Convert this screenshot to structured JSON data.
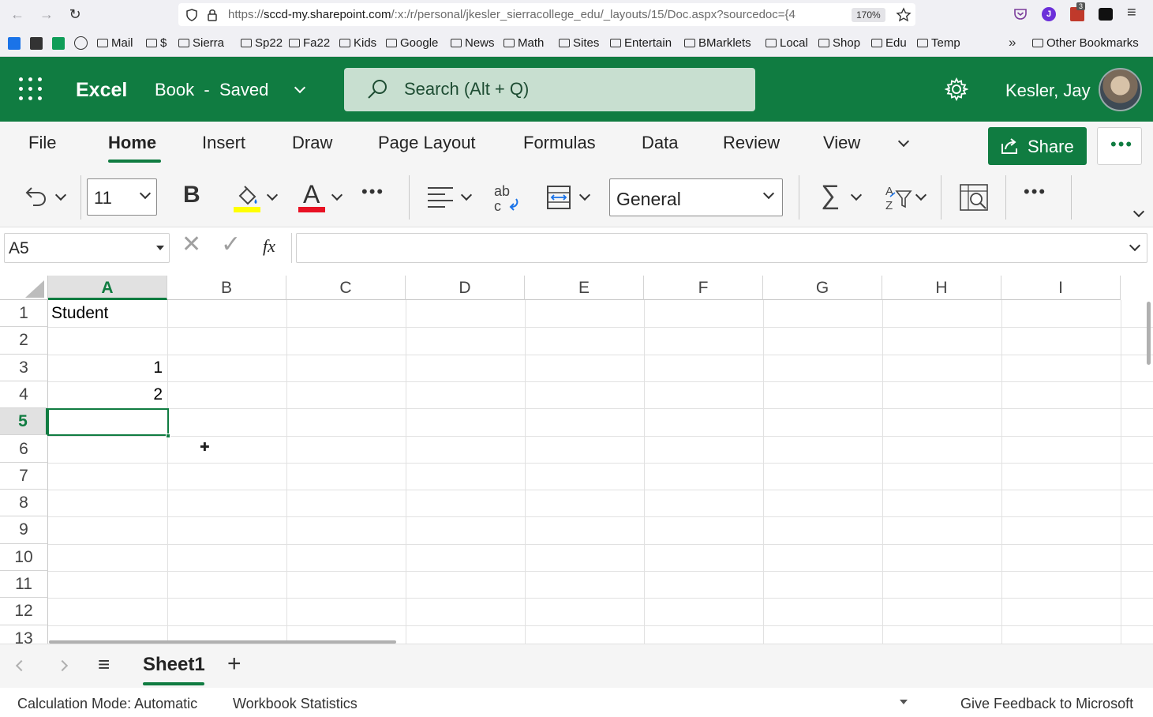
{
  "browser": {
    "url_host": "sccd-my.sharepoint.com",
    "url_prefix": "https://",
    "url_rest": "/:x:/r/personal/jkesler_sierracollege_edu/_layouts/15/Doc.aspx?sourcedoc={4",
    "zoom": "170%",
    "bookmarks": [
      "Mail",
      "$",
      "Sierra",
      "Sp22",
      "Fa22",
      "Kids",
      "Google",
      "News",
      "Math",
      "Sites",
      "Entertain",
      "BMarklets",
      "Local",
      "Shop",
      "Edu",
      "Temp"
    ],
    "other_bookmarks": "Other Bookmarks",
    "ext_badge": "3"
  },
  "app": {
    "name": "Excel",
    "doc_title": "Book",
    "doc_sep": "-",
    "doc_status": "Saved",
    "search_placeholder": "Search (Alt + Q)",
    "user_name": "Kesler, Jay",
    "brand_color": "#107c41"
  },
  "ribbon": {
    "tabs": [
      "File",
      "Home",
      "Insert",
      "Draw",
      "Page Layout",
      "Formulas",
      "Data",
      "Review",
      "View"
    ],
    "active_tab": "Home",
    "share_label": "Share",
    "font_size": "11",
    "bold_label": "B",
    "font_color_letter": "A",
    "number_format": "General"
  },
  "formula_bar": {
    "name_box": "A5",
    "fx": "fx",
    "value": ""
  },
  "grid": {
    "columns": [
      "A",
      "B",
      "C",
      "D",
      "E",
      "F",
      "G",
      "H",
      "I"
    ],
    "rows": [
      "1",
      "2",
      "3",
      "4",
      "5",
      "6",
      "7",
      "8",
      "9",
      "10",
      "11",
      "12",
      "13"
    ],
    "selected_cell": "A5",
    "cells": {
      "A1": "Student",
      "A3": "1",
      "A4": "2"
    }
  },
  "sheets": {
    "tabs": [
      "Sheet1"
    ],
    "active": "Sheet1"
  },
  "status": {
    "calc_mode": "Calculation Mode: Automatic",
    "workbook_stats": "Workbook Statistics",
    "feedback": "Give Feedback to Microsoft"
  }
}
